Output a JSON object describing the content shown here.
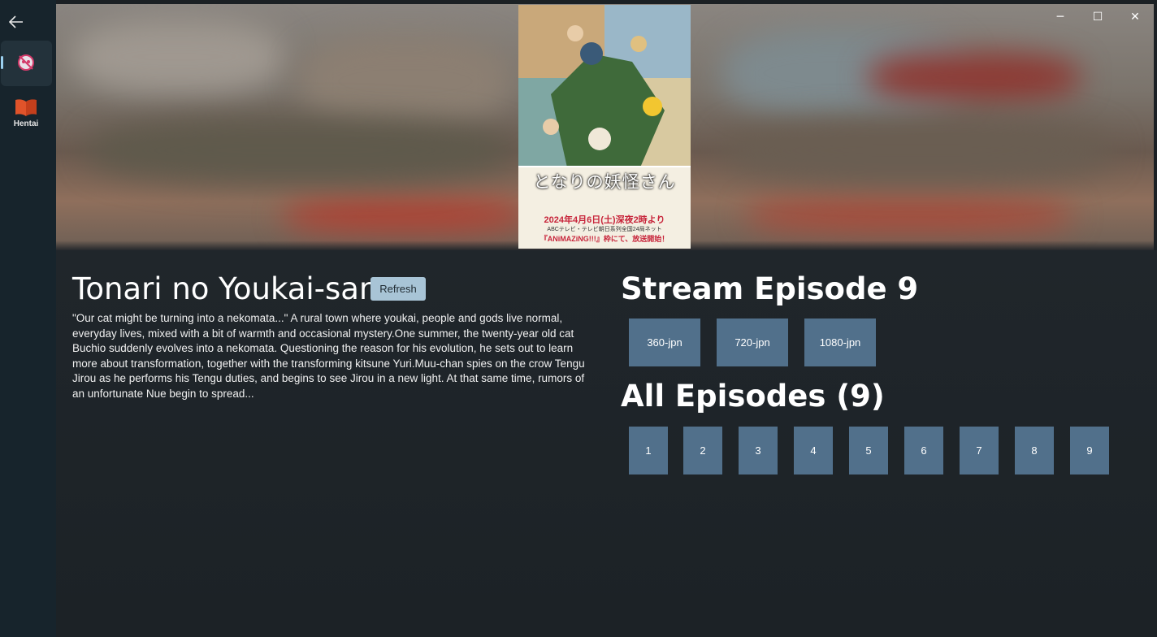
{
  "nav": {
    "back_icon": "back-arrow-icon",
    "items": [
      {
        "label": "",
        "icon": "anime-mascot-icon",
        "active": true
      },
      {
        "label": "Hentai",
        "icon": "book-icon",
        "active": false
      }
    ]
  },
  "window_controls": {
    "minimize": "─",
    "maximize": "☐",
    "close": "✕"
  },
  "poster": {
    "title_jp": "となりの妖怪さん",
    "date_line": "2024年4月6日(土)深夜2時より",
    "network_line": "ABCテレビ・テレビ朝日系列全国24局ネット",
    "block_line": "『ANiMAZiNG!!!』枠にて、放送開始！"
  },
  "anime": {
    "title": "Tonari no Youkai-san",
    "refresh_label": "Refresh",
    "description": "\"Our cat might be turning into a nekomata...\" A rural town where youkai, people and gods live normal, everyday lives, mixed with a bit of warmth and occasional mystery.One summer, the twenty-year old cat Buchio suddenly evolves into a nekomata. Questioning the reason for his evolution, he sets out to learn more about transformation, together with the transforming kitsune Yuri.Muu-chan spies on the crow Tengu Jirou as he performs his Tengu duties, and begins to see Jirou in a new light. At that same time, rumors of an unfortunate Nue begin to spread..."
  },
  "stream": {
    "heading": "Stream Episode 9",
    "qualities": [
      "360-jpn",
      "720-jpn",
      "1080-jpn"
    ]
  },
  "episodes": {
    "heading": "All Episodes (9)",
    "list": [
      "1",
      "2",
      "3",
      "4",
      "5",
      "6",
      "7",
      "8",
      "9"
    ]
  },
  "colors": {
    "accent_button": "#51708b",
    "refresh_button": "#a8c4d6",
    "nav_background": "#17242c",
    "content_background": "#1e2428"
  }
}
